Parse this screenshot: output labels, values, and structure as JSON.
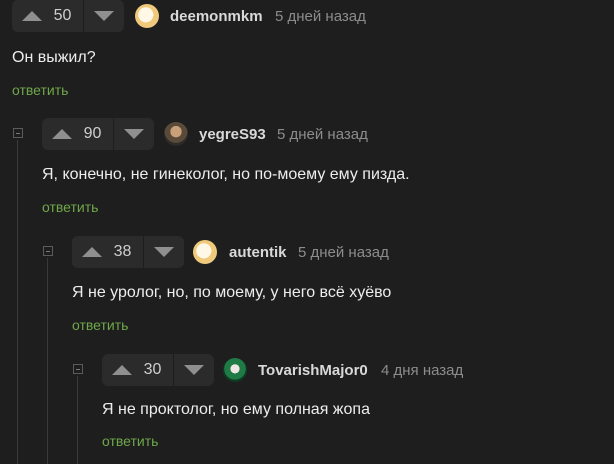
{
  "comments": [
    {
      "score": "50",
      "username": "deemonmkm",
      "time": "5 дней назад",
      "text": "Он выжил?",
      "reply_label": "ответить",
      "avatar_icon": "avatar-blob-icon"
    },
    {
      "score": "90",
      "username": "yegreS93",
      "time": "5 дней назад",
      "text": "Я, конечно, не гинеколог, но по-моему ему пизда.",
      "reply_label": "ответить",
      "avatar_icon": "avatar-face-icon"
    },
    {
      "score": "38",
      "username": "autentik",
      "time": "5 дней назад",
      "text": "Я не уролог, но, по моему, у него всё хуёво",
      "reply_label": "ответить",
      "avatar_icon": "avatar-blob-icon"
    },
    {
      "score": "30",
      "username": "TovarishMajor0",
      "time": "4 дня назад",
      "text": "Я не проктолог, но ему полная жопа",
      "reply_label": "ответить",
      "avatar_icon": "avatar-green-icon"
    }
  ],
  "colors": {
    "background": "#1e1e1e",
    "vote_bg": "#2b2b2b",
    "reply_link": "#6fa84a",
    "muted": "#8c8c8c"
  }
}
